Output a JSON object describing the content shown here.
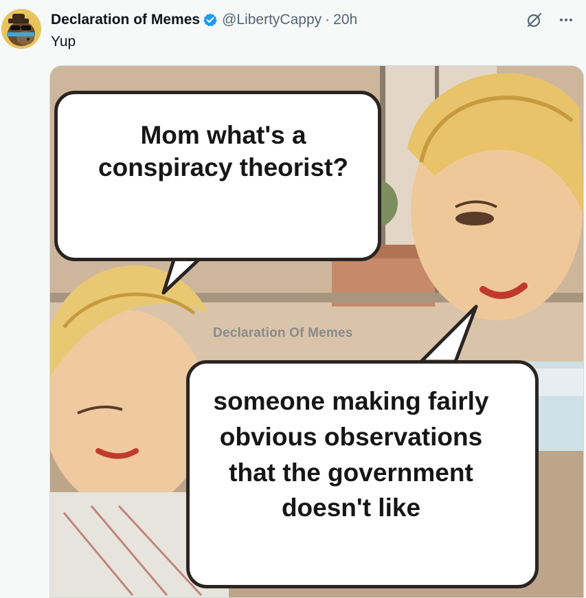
{
  "tweet": {
    "author": {
      "display_name": "Declaration of Memes",
      "handle": "@LibertyCappy",
      "verified": true,
      "avatar_icon": "cartoon-capybara-avatar"
    },
    "separator": "·",
    "timestamp": "20h",
    "text": "Yup",
    "actions": {
      "grok_icon": "grok-icon",
      "more_icon": "more-icon"
    },
    "media": {
      "bubble_top": "Mom what's a conspiracy theorist?",
      "bubble_bottom": "someone making fairly obvious observations that the government doesn't like",
      "watermark": "Declaration Of Memes"
    }
  },
  "colors": {
    "background": "#f7f9f9",
    "text_primary": "#0f1419",
    "text_secondary": "#536471",
    "verified_blue": "#1d9bf0"
  }
}
